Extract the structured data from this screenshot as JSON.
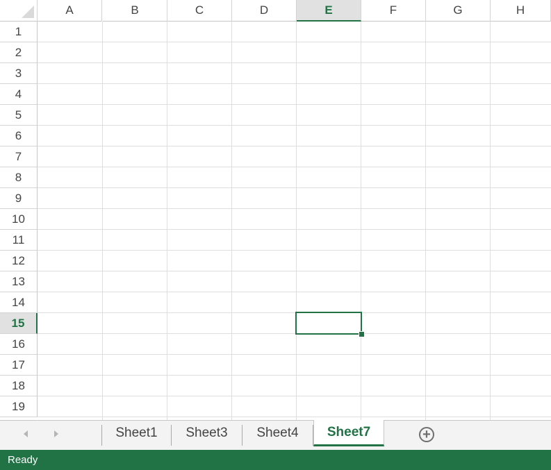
{
  "columns": [
    "A",
    "B",
    "C",
    "D",
    "E",
    "F",
    "G",
    "H"
  ],
  "rows": [
    "1",
    "2",
    "3",
    "4",
    "5",
    "6",
    "7",
    "8",
    "9",
    "10",
    "11",
    "12",
    "13",
    "14",
    "15",
    "16",
    "17",
    "18",
    "19"
  ],
  "active_column": "E",
  "active_row": "15",
  "sheets": [
    {
      "label": "Sheet1",
      "active": false
    },
    {
      "label": "Sheet3",
      "active": false
    },
    {
      "label": "Sheet4",
      "active": false
    },
    {
      "label": "Sheet7",
      "active": true
    }
  ],
  "add_sheet_symbol": "+",
  "status": {
    "text": "Ready"
  },
  "colors": {
    "accent": "#217346",
    "gridline": "#dedede",
    "header_active_bg": "#e1e1e1"
  },
  "icons": {
    "prev_sheet": "triangle-left-icon",
    "next_sheet": "triangle-right-icon",
    "new_sheet": "plus-circle-icon"
  }
}
